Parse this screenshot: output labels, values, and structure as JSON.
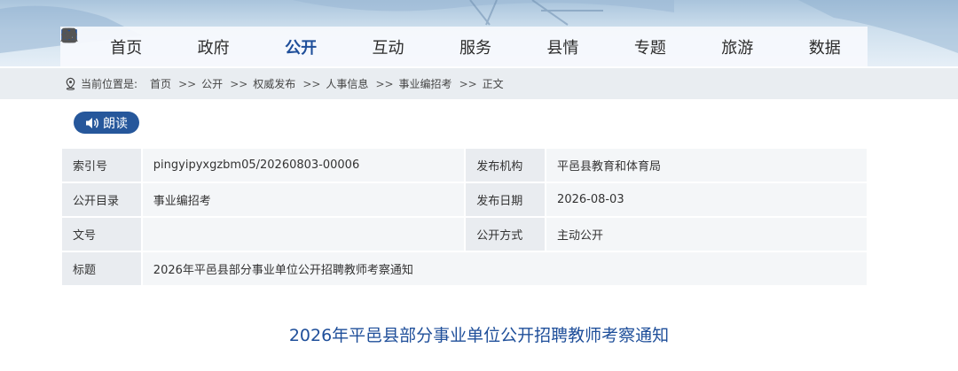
{
  "nav": {
    "items": [
      {
        "label": "首页",
        "icon": "home-icon",
        "active": false
      },
      {
        "label": "政府",
        "icon": "monitor-icon",
        "active": false
      },
      {
        "label": "公开",
        "icon": "book-icon",
        "active": true
      },
      {
        "label": "互动",
        "icon": "handshake-icon",
        "active": false
      },
      {
        "label": "服务",
        "icon": "service-icon",
        "active": false
      },
      {
        "label": "县情",
        "icon": "building-icon",
        "active": false
      },
      {
        "label": "专题",
        "icon": "star-doc-icon",
        "active": false
      },
      {
        "label": "旅游",
        "icon": "mountain-icon",
        "active": false
      },
      {
        "label": "数据",
        "icon": "database-icon",
        "active": false
      }
    ],
    "active_color": "#1f4f9a"
  },
  "breadcrumb": {
    "prefix": "当前位置是:",
    "separator": ">>",
    "items": [
      "首页",
      "公开",
      "权威发布",
      "人事信息",
      "事业编招考",
      "正文"
    ]
  },
  "read_button": {
    "label": "朗读",
    "color": "#26579b"
  },
  "meta": {
    "rows": [
      {
        "label1": "索引号",
        "value1": "pingyipyxgzbm05/20260803-00006",
        "label2": "发布机构",
        "value2": "平邑县教育和体育局"
      },
      {
        "label1": "公开目录",
        "value1": "事业编招考",
        "label2": "发布日期",
        "value2": "2026-08-03"
      },
      {
        "label1": "文号",
        "value1": "",
        "label2": "公开方式",
        "value2": "主动公开"
      },
      {
        "label1": "标题",
        "value1": "2026年平邑县部分事业单位公开招聘教师考察通知"
      }
    ]
  },
  "article": {
    "title": "2026年平邑县部分事业单位公开招聘教师考察通知"
  }
}
